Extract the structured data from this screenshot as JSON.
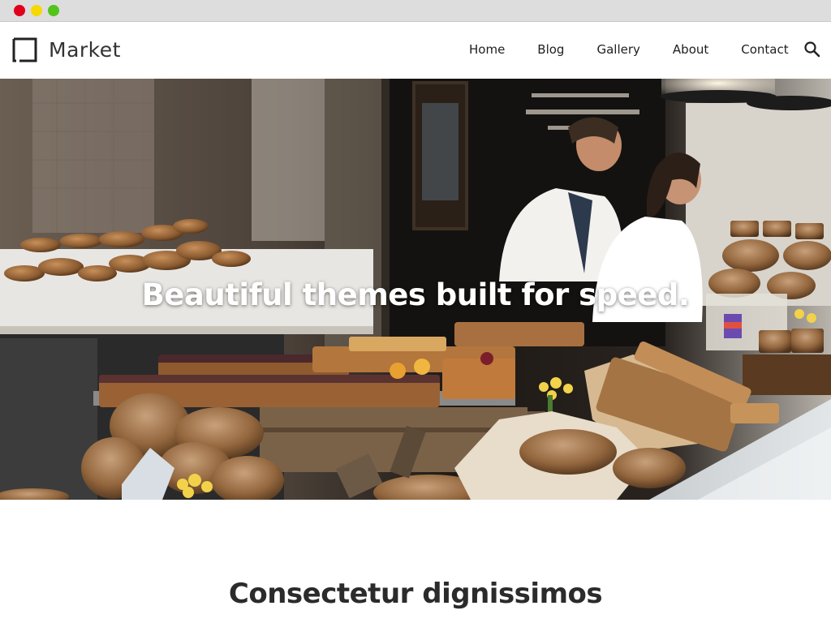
{
  "window": {
    "buttons": [
      "close",
      "minimize",
      "maximize"
    ],
    "colors": {
      "close": "#e0001b",
      "minimize": "#f5d900",
      "maximize": "#52c41a"
    }
  },
  "header": {
    "brand": "Market",
    "logo_icon": "square-bracket-logo-icon",
    "nav": [
      {
        "label": "Home"
      },
      {
        "label": "Blog"
      },
      {
        "label": "Gallery"
      },
      {
        "label": "About"
      },
      {
        "label": "Contact"
      }
    ],
    "search_icon": "search-icon"
  },
  "hero": {
    "title": "Beautiful themes built for speed."
  },
  "section": {
    "title": "Consectetur dignissimos"
  }
}
